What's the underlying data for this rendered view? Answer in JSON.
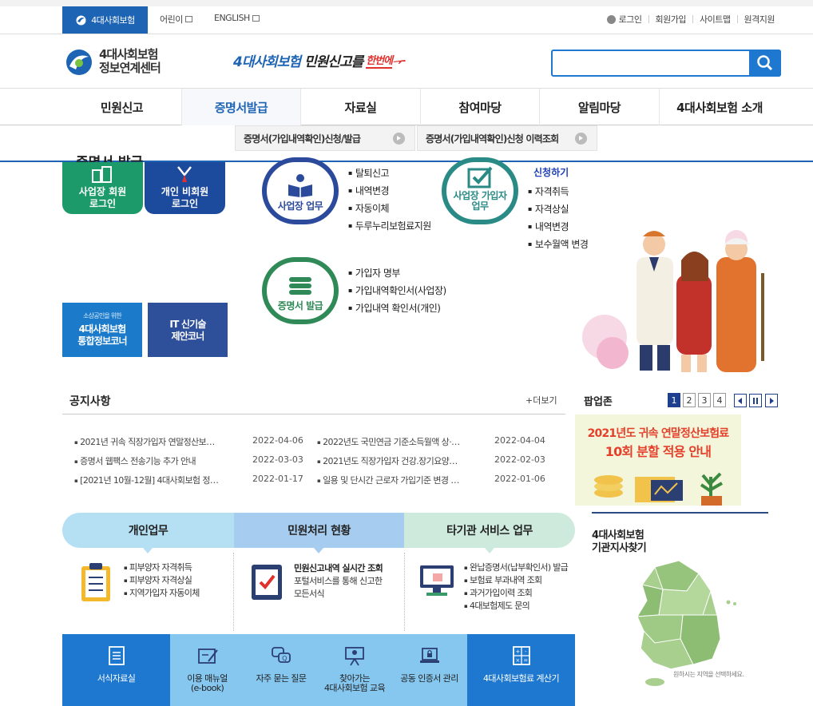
{
  "topbar": {
    "brand": "4대사회보험",
    "links": [
      "어린이",
      "ENGLISH"
    ],
    "right": [
      "로그인",
      "회원가입",
      "사이트맵",
      "원격지원"
    ]
  },
  "header": {
    "logo_line1": "4대사회보험",
    "logo_line2": "정보연계센터",
    "slogan_blue": "4대사회보험",
    "slogan_dark": "민원신고를",
    "slogan_red": "한번에",
    "search_placeholder": ""
  },
  "gnb": [
    "민원신고",
    "증명서발급",
    "자료실",
    "참여마당",
    "알림마당",
    "4대사회보험 소개"
  ],
  "submenu": [
    "증명서(가입내역확인)신청/발급",
    "증명서(가입내역확인)신청 이력조회"
  ],
  "hidden_heading": "증명서 발급",
  "quick": [
    {
      "label": "사업장 회원\n로그인",
      "color": "#1d9a69"
    },
    {
      "label": "개인 비회원\n로그인",
      "color": "#1c4a9c"
    }
  ],
  "circles": [
    {
      "label": "사업장 업무",
      "items": [
        "탈퇴신고",
        "내역변경",
        "자동이체",
        "두루누리보험료지원"
      ]
    },
    {
      "label": "사업장 가입자\n업무",
      "apply": "신청하기",
      "items": [
        "자격취득",
        "자격상실",
        "내역변경",
        "보수월액 변경"
      ]
    },
    {
      "label": "증명서 발급",
      "items": [
        "가입자 명부",
        "가입내역확인서(사업장)",
        "가입내역 확인서(개인)"
      ]
    }
  ],
  "banners": [
    {
      "small": "소상공인을 위한",
      "label": "4대사회보험\n통합정보코너"
    },
    {
      "label": "IT 신기술\n제안코너"
    }
  ],
  "notice": {
    "title": "공지사항",
    "more": "+더보기",
    "left": [
      {
        "title": "2021년 귀속 직장가입자 연말정산보…",
        "date": "2022-04-06"
      },
      {
        "title": "증명서 웹팩스 전송기능 추가 안내",
        "date": "2022-03-03"
      },
      {
        "title": "[2021년 10월-12월] 4대사회보험 정…",
        "date": "2022-01-17"
      }
    ],
    "right": [
      {
        "title": "2022년도 국민연금 기준소득월액 상·…",
        "date": "2022-04-04"
      },
      {
        "title": "2021년도 직장가입자 건강.장기요양…",
        "date": "2022-02-03"
      },
      {
        "title": "일용 및 단시간 근로자 가입기준 변경 …",
        "date": "2022-01-06"
      }
    ]
  },
  "popup": {
    "title": "팝업존",
    "pages": [
      "1",
      "2",
      "3",
      "4"
    ],
    "banner_line1": "2021년도 귀속 연말정산보험료",
    "banner_line2": "10회 분할 적용 안내"
  },
  "tabs": [
    "개인업무",
    "민원처리 현황",
    "타기관 서비스 업무"
  ],
  "services": {
    "personal": [
      "피부양자 자격취득",
      "피부양자 자격상실",
      "지역가입자 자동이체"
    ],
    "status_title": "민원신고내역 실시간 조회",
    "status_desc": "포털서비스를 통해 신고한\n모든서식",
    "other": [
      "완납증명서(납부확인서) 발급",
      "보험료 부과내역 조회",
      "과거가입이력 조회",
      "4대보험제도 문의"
    ]
  },
  "bottom_menu": [
    "서식자료실",
    "이용 매뉴얼\n(e-book)",
    "자주 묻는 질문",
    "찾아가는\n4대사회보험 교육",
    "공동 인증서 관리",
    "4대사회보험료 계산기"
  ],
  "find": {
    "title_line1": "4대사회보험",
    "title_line2": "기관지사찾기",
    "hint": "원하시는 지역을 선택하세요."
  },
  "colors": {
    "brand": "#1e64b4",
    "accent": "#1e78d0",
    "green": "#1d9a69"
  }
}
